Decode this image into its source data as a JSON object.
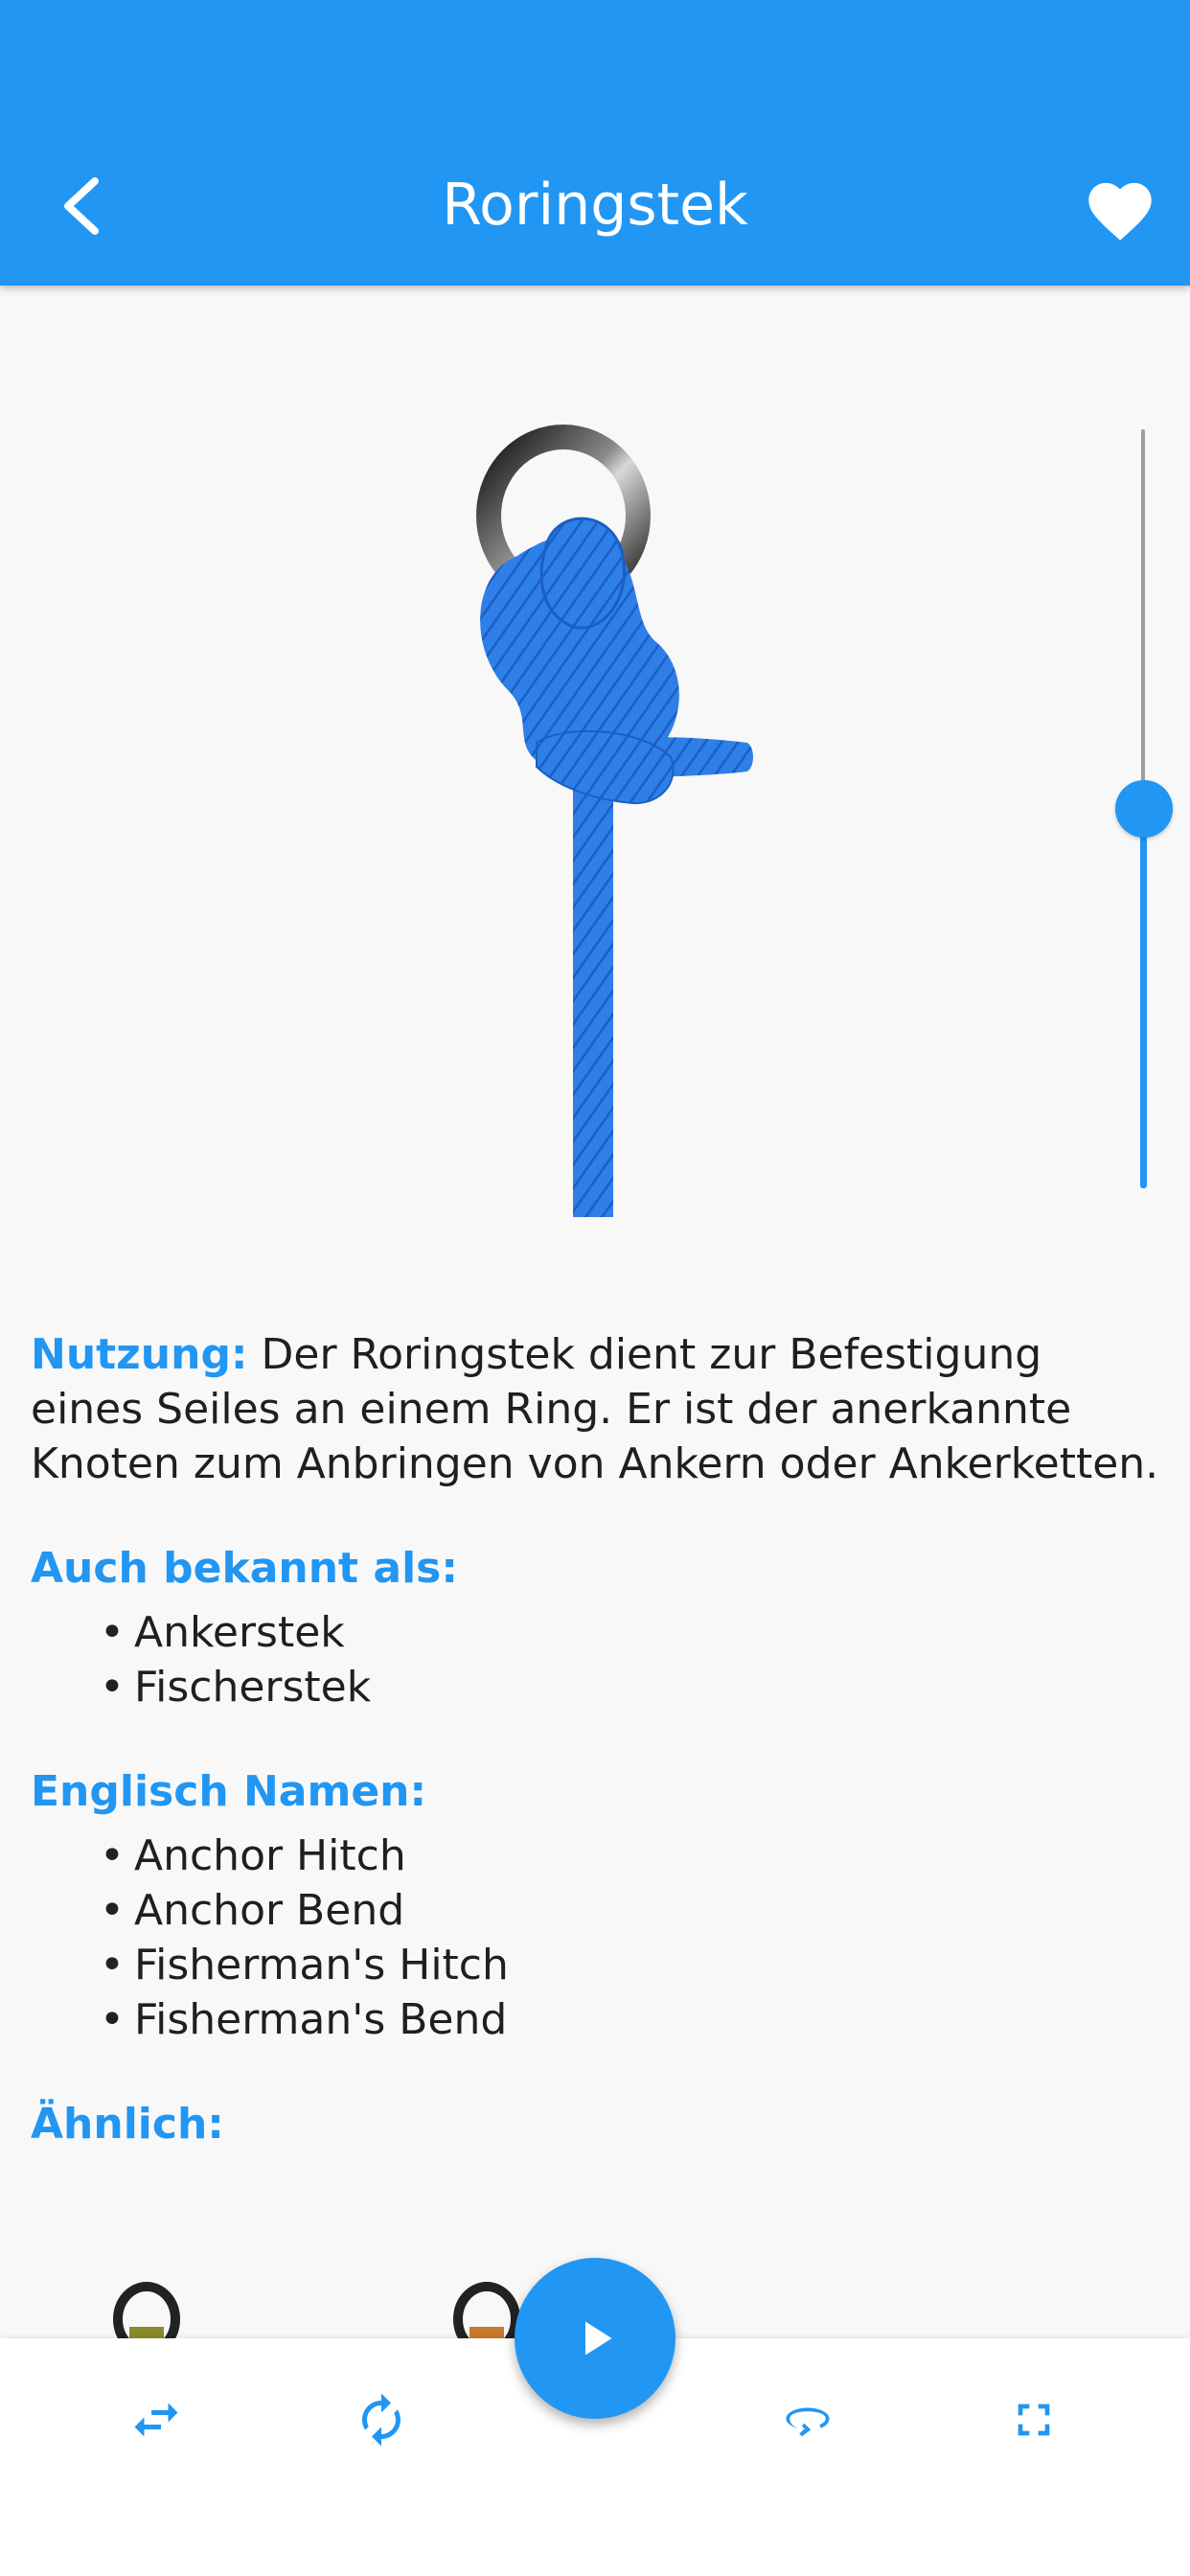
{
  "header": {
    "title": "Roringstek",
    "back_icon": "back-arrow-icon",
    "favorite_icon": "heart-icon"
  },
  "colors": {
    "accent": "#2196f3",
    "rope": "#2f7fe8",
    "ring": "#3a3a3a",
    "background": "#f8f8f8"
  },
  "animation": {
    "progress": 0.5
  },
  "usage": {
    "label": "Nutzung:",
    "text": " Der Roringstek dient zur Befestigung eines Seiles an einem Ring. Er ist der anerkannte Knoten zum Anbringen von Ankern oder Ankerketten."
  },
  "aka": {
    "heading": "Auch bekannt als:",
    "items": [
      "Ankerstek",
      "Fischerstek"
    ]
  },
  "english": {
    "heading": "Englisch Namen:",
    "items": [
      "Anchor Hitch",
      "Anchor Bend",
      "Fisherman's Hitch",
      "Fisherman's Bend"
    ]
  },
  "similar": {
    "heading": "Ähnlich:"
  },
  "bottom_bar": {
    "swap_icon": "swap-arrows-icon",
    "rotate_icon": "rotate-icon",
    "play_icon": "play-icon",
    "loop_icon": "loop-icon",
    "fullscreen_icon": "fullscreen-icon"
  }
}
